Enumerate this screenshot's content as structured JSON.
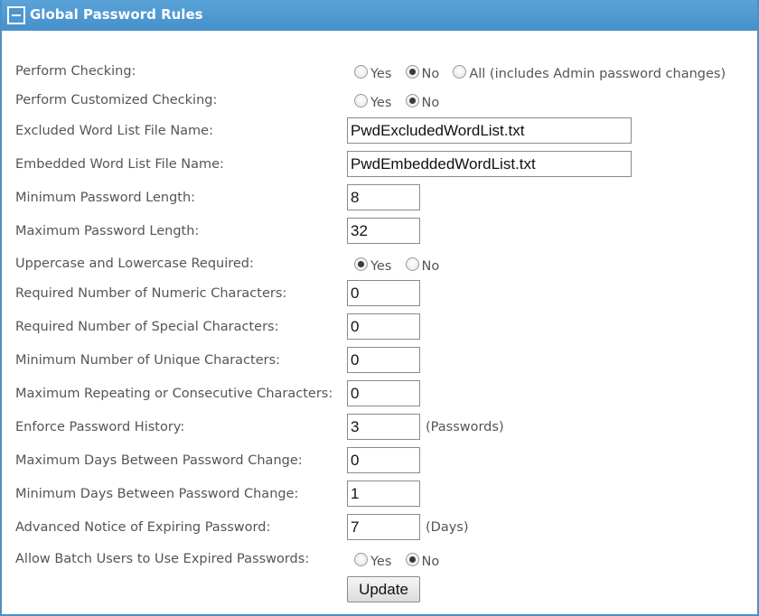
{
  "panel": {
    "title": "Global Password Rules"
  },
  "rows": {
    "perform_checking": {
      "label": "Perform Checking:",
      "options": [
        "Yes",
        "No",
        "All (includes Admin password changes)"
      ],
      "selected": "No"
    },
    "perform_customized": {
      "label": "Perform Customized Checking:",
      "options": [
        "Yes",
        "No"
      ],
      "selected": "No"
    },
    "excluded_word_list": {
      "label": "Excluded Word List File Name:",
      "value": "PwdExcludedWordList.txt"
    },
    "embedded_word_list": {
      "label": "Embedded Word List File Name:",
      "value": "PwdEmbeddedWordList.txt"
    },
    "min_length": {
      "label": "Minimum Password Length:",
      "value": "8"
    },
    "max_length": {
      "label": "Maximum Password Length:",
      "value": "32"
    },
    "upper_lower": {
      "label": "Uppercase and Lowercase Required:",
      "options": [
        "Yes",
        "No"
      ],
      "selected": "Yes"
    },
    "numeric": {
      "label": "Required Number of Numeric Characters:",
      "value": "0"
    },
    "special": {
      "label": "Required Number of Special Characters:",
      "value": "0"
    },
    "unique": {
      "label": "Minimum Number of Unique Characters:",
      "value": "0"
    },
    "repeating": {
      "label": "Maximum Repeating or Consecutive Characters:",
      "value": "0"
    },
    "history": {
      "label": "Enforce Password History:",
      "value": "3",
      "suffix": "(Passwords)"
    },
    "max_days": {
      "label": "Maximum Days Between Password Change:",
      "value": "0"
    },
    "min_days": {
      "label": "Minimum Days Between Password Change:",
      "value": "1"
    },
    "notice": {
      "label": "Advanced Notice of Expiring Password:",
      "value": "7",
      "suffix": "(Days)"
    },
    "batch_users": {
      "label": "Allow Batch Users to Use Expired Passwords:",
      "options": [
        "Yes",
        "No"
      ],
      "selected": "No"
    }
  },
  "actions": {
    "update_label": "Update"
  },
  "colors": {
    "header": "#4b97d0",
    "border": "#4a90c8",
    "label": "#555555"
  }
}
